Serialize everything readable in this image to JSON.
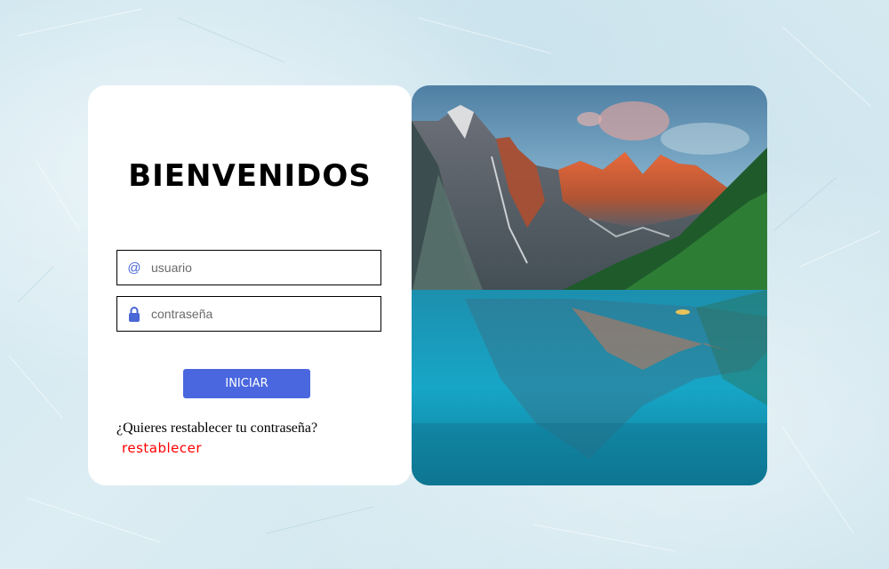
{
  "login": {
    "title": "BIENVENIDOS",
    "username_placeholder": "usuario",
    "username_icon": "at-icon",
    "username_icon_glyph": "@",
    "password_placeholder": "contraseña",
    "password_icon": "lock-icon",
    "submit_label": "INICIAR",
    "reset_question": "¿Quieres restablecer tu contraseña?",
    "reset_link": "restablecer"
  },
  "image": {
    "subject": "mountain lake landscape"
  },
  "colors": {
    "accent": "#4a67e0",
    "link": "#ff0000",
    "panel": "#ffffff"
  }
}
